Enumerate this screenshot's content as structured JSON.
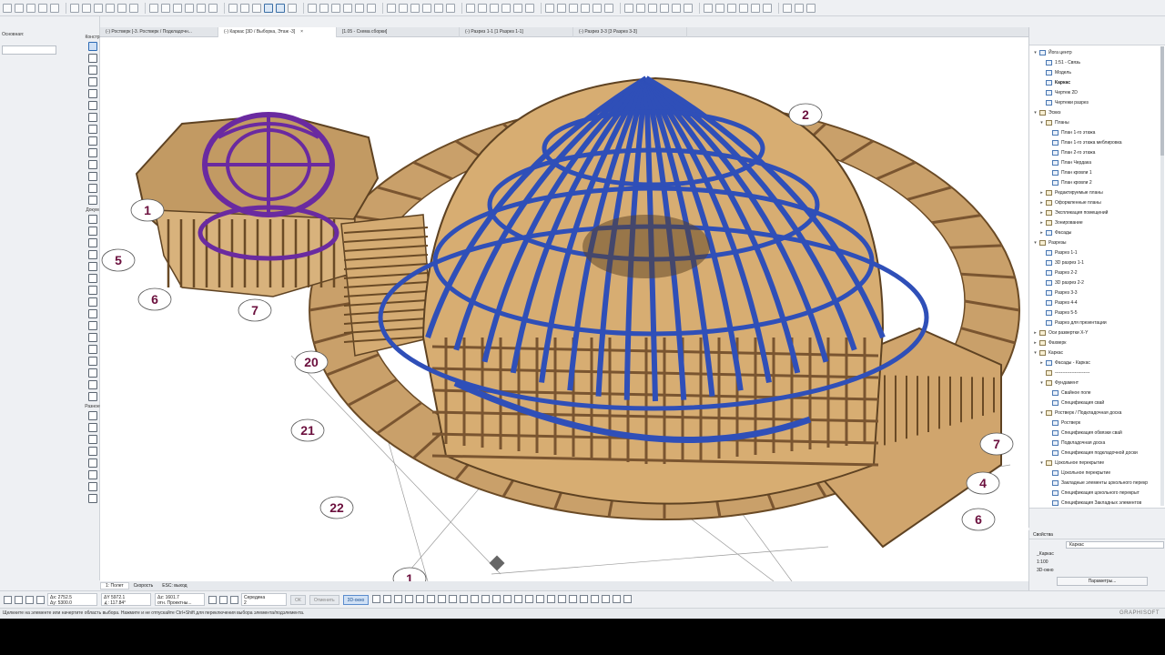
{
  "toolbox": {
    "header": "Основная:",
    "groups": [
      "Констр",
      "Докум",
      "Разное"
    ]
  },
  "tabs": [
    {
      "label": "(-) Ростверк [-3. Ростверк / Подкладочн..."
    },
    {
      "label": "(-) Каркас [3D / Выборка, Этаж -3]",
      "active": true,
      "close": "×"
    },
    {
      "label": "[1.05 - Схема сборки]"
    },
    {
      "label": "(-) Разрез 1-1 [1 Разрез 1-1]"
    },
    {
      "label": "(-) Разрез 3-3 [3 Разрез 3-3]"
    }
  ],
  "grid_labels": [
    "1",
    "2",
    "4",
    "5",
    "6",
    "6",
    "7",
    "7",
    "20",
    "21",
    "22",
    "1"
  ],
  "viewtabs": {
    "view": "1: Полет",
    "speed": "Скорость",
    "esc": "ESC: выход"
  },
  "infobox": {
    "dx": "Δх: 2752.5",
    "dy": "Δу: 5300.0",
    "r": "ΔY 5972.1",
    "a": "∡: 117.84°",
    "dz": "Δz: 1601.7",
    "proj": "отн. Проектны...",
    "mode": "Середина",
    "mode2": "2",
    "ok": "ОК",
    "cancel": "Отменить",
    "window3d": "3D-окно"
  },
  "status": "Щелкните на элементе или начертите область выбора. Нажмите и не отпускайте Ctrl+Shift для переключения выбора элемента/подэлемента.",
  "brand": "GRAPHISOFT",
  "navigator": {
    "items": [
      {
        "label": "Йога центр",
        "level": 0,
        "tw": "▾"
      },
      {
        "label": "1:51 - Связь",
        "level": 1
      },
      {
        "label": "Модель",
        "level": 1
      },
      {
        "label": "Каркас",
        "level": 1,
        "bold": true
      },
      {
        "label": "Чертеж 2D",
        "level": 1
      },
      {
        "label": "Чертежи разрез",
        "level": 1
      },
      {
        "label": "Эскиз",
        "level": 0,
        "tw": "▾",
        "folder": true
      },
      {
        "label": "Планы",
        "level": 1,
        "tw": "▾",
        "folder": true
      },
      {
        "label": "План 1-го этажа",
        "level": 2
      },
      {
        "label": "План 1-го этажа меблировка",
        "level": 2
      },
      {
        "label": "План 2-го этажа",
        "level": 2
      },
      {
        "label": "План Чердака",
        "level": 2
      },
      {
        "label": "План кровли 1",
        "level": 2
      },
      {
        "label": "План кровли 2",
        "level": 2
      },
      {
        "label": "Редактируемые планы",
        "level": 1,
        "tw": "▸",
        "folder": true
      },
      {
        "label": "Оформленные планы",
        "level": 1,
        "tw": "▸",
        "folder": true
      },
      {
        "label": "Экспликация помещений",
        "level": 1,
        "tw": "▸",
        "folder": true
      },
      {
        "label": "Зонирование",
        "level": 1,
        "tw": "▸",
        "folder": true
      },
      {
        "label": "Фасады",
        "level": 1,
        "tw": "▸"
      },
      {
        "label": "Разрезы",
        "level": 0,
        "tw": "▾",
        "folder": true
      },
      {
        "label": "Разрез 1-1",
        "level": 1
      },
      {
        "label": "3D разрез 1-1",
        "level": 1
      },
      {
        "label": "Разрез 2-2",
        "level": 1
      },
      {
        "label": "3D разрез 2-2",
        "level": 1
      },
      {
        "label": "Разрез 3-3",
        "level": 1
      },
      {
        "label": "Разрез 4-4",
        "level": 1
      },
      {
        "label": "Разрез 5-5",
        "level": 1
      },
      {
        "label": "Разрез для презентации",
        "level": 1
      },
      {
        "label": "Оси развертки Х-Y",
        "level": 0,
        "tw": "▸",
        "folder": true
      },
      {
        "label": "Фахверк",
        "level": 0,
        "tw": "▸",
        "folder": true
      },
      {
        "label": "Каркас",
        "level": 0,
        "tw": "▾",
        "folder": true
      },
      {
        "label": "Фасады - Каркас",
        "level": 1,
        "tw": "▸"
      },
      {
        "label": "-----------------------",
        "level": 1,
        "folder": true
      },
      {
        "label": "Фундамент",
        "level": 1,
        "tw": "▾",
        "folder": true
      },
      {
        "label": "Свайное поле",
        "level": 2
      },
      {
        "label": "Спецификация свай",
        "level": 2
      },
      {
        "label": "Ростверк / Подкладочная доска",
        "level": 1,
        "tw": "▾",
        "folder": true
      },
      {
        "label": "Ростверк",
        "level": 2
      },
      {
        "label": "Спецификация обвязки свай",
        "level": 2
      },
      {
        "label": "Подкладочная доска",
        "level": 2
      },
      {
        "label": "Спецификация подкладочной доски",
        "level": 2
      },
      {
        "label": "Цокольное перекрытие",
        "level": 1,
        "tw": "▾",
        "folder": true
      },
      {
        "label": "Цокольное перекрытие",
        "level": 2
      },
      {
        "label": "Закладные элементы цокольного перекр",
        "level": 2
      },
      {
        "label": "Спецификация цокольного перекрыт",
        "level": 2
      },
      {
        "label": "Спецификация Закладных элементов",
        "level": 2
      }
    ]
  },
  "properties": {
    "title": "Свойства",
    "value": "Каркас",
    "rows": [
      "_Каркас",
      "1:100",
      "3D-окно"
    ],
    "button": "Параметры..."
  },
  "colors": {
    "dome_frame": "#2f4fb8",
    "small_dome": "#6a2aa0",
    "wood": "#b58a54",
    "label": "#6b0f3d"
  }
}
